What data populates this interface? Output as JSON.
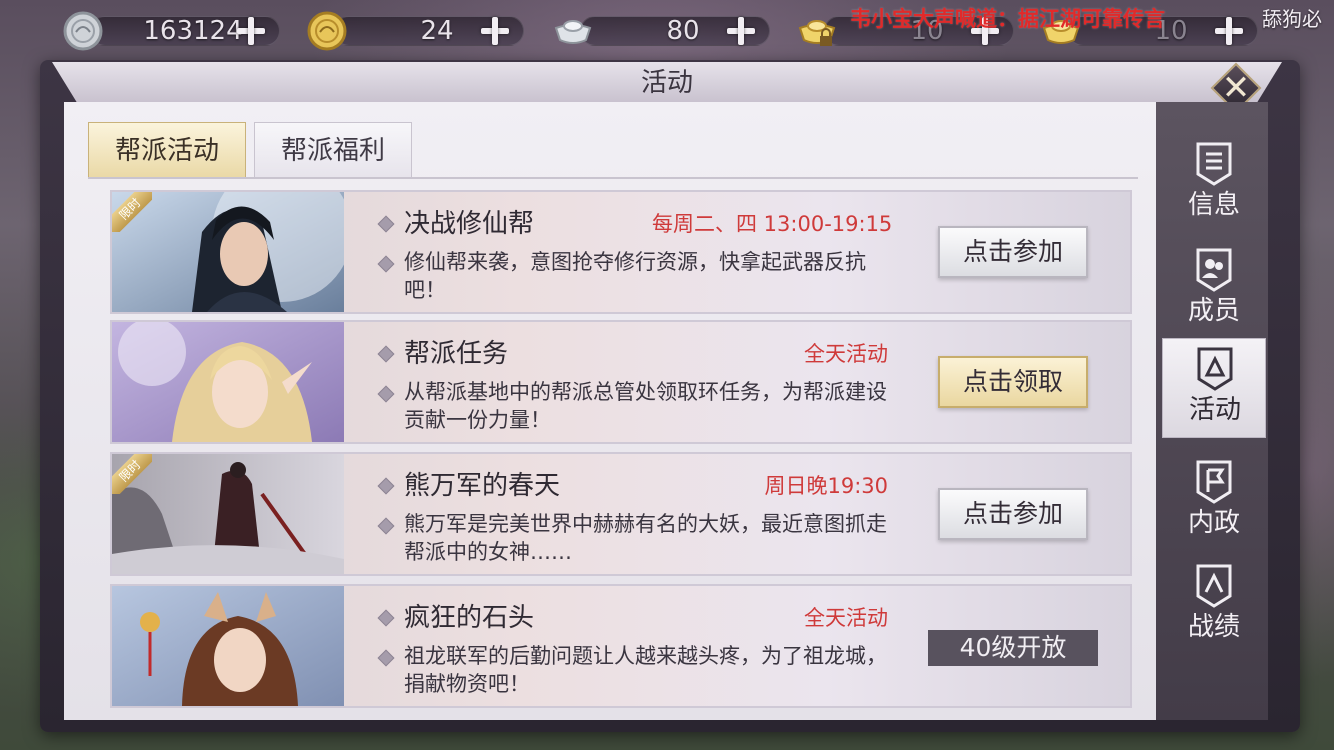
{
  "currencies": [
    {
      "icon": "silver-coin-icon",
      "value": "163124"
    },
    {
      "icon": "gold-coin-icon",
      "value": "24"
    },
    {
      "icon": "silver-ingot-icon",
      "value": "80"
    },
    {
      "icon": "locked-gold-ingot-icon",
      "value": "10"
    },
    {
      "icon": "gold-ingot-icon",
      "value": "10"
    }
  ],
  "broadcast": "韦小宝大声喊道：据江湖可靠传言",
  "corner_text": "舔狗必",
  "panel": {
    "title": "活动"
  },
  "tabs": [
    {
      "label": "帮派活动",
      "active": true
    },
    {
      "label": "帮派福利",
      "active": false
    }
  ],
  "activities": [
    {
      "title": "决战修仙帮",
      "time": "每周二、四 13:00-19:15",
      "desc": "修仙帮来袭，意图抢夺修行资源，快拿起武器反抗吧！",
      "button": "点击参加",
      "limited": true,
      "limited_label": "限时"
    },
    {
      "title": "帮派任务",
      "time": "全天活动",
      "desc": "从帮派基地中的帮派总管处领取环任务，为帮派建设贡献一份力量！",
      "button": "点击领取",
      "limited": false
    },
    {
      "title": "熊万军的春天",
      "time": "周日晚19:30",
      "desc": "熊万军是完美世界中赫赫有名的大妖，最近意图抓走帮派中的女神……",
      "button": "点击参加",
      "limited": true,
      "limited_label": "限时"
    },
    {
      "title": "疯狂的石头",
      "time": "全天活动",
      "desc": "祖龙联军的后勤问题让人越来越头疼，为了祖龙城，捐献物资吧！",
      "button": "40级开放",
      "limited": false
    }
  ],
  "sidenav": [
    {
      "label": "信息",
      "icon": "info-scroll-icon",
      "active": false
    },
    {
      "label": "成员",
      "icon": "members-icon",
      "active": false
    },
    {
      "label": "活动",
      "icon": "activity-flag-icon",
      "active": true
    },
    {
      "label": "内政",
      "icon": "affairs-flag-icon",
      "active": false
    },
    {
      "label": "战绩",
      "icon": "record-flag-icon",
      "active": false
    }
  ],
  "colors": {
    "accent_red": "#cf3a3a",
    "tab_gold": "#ead9a7",
    "broadcast_red": "#e12a2a"
  }
}
